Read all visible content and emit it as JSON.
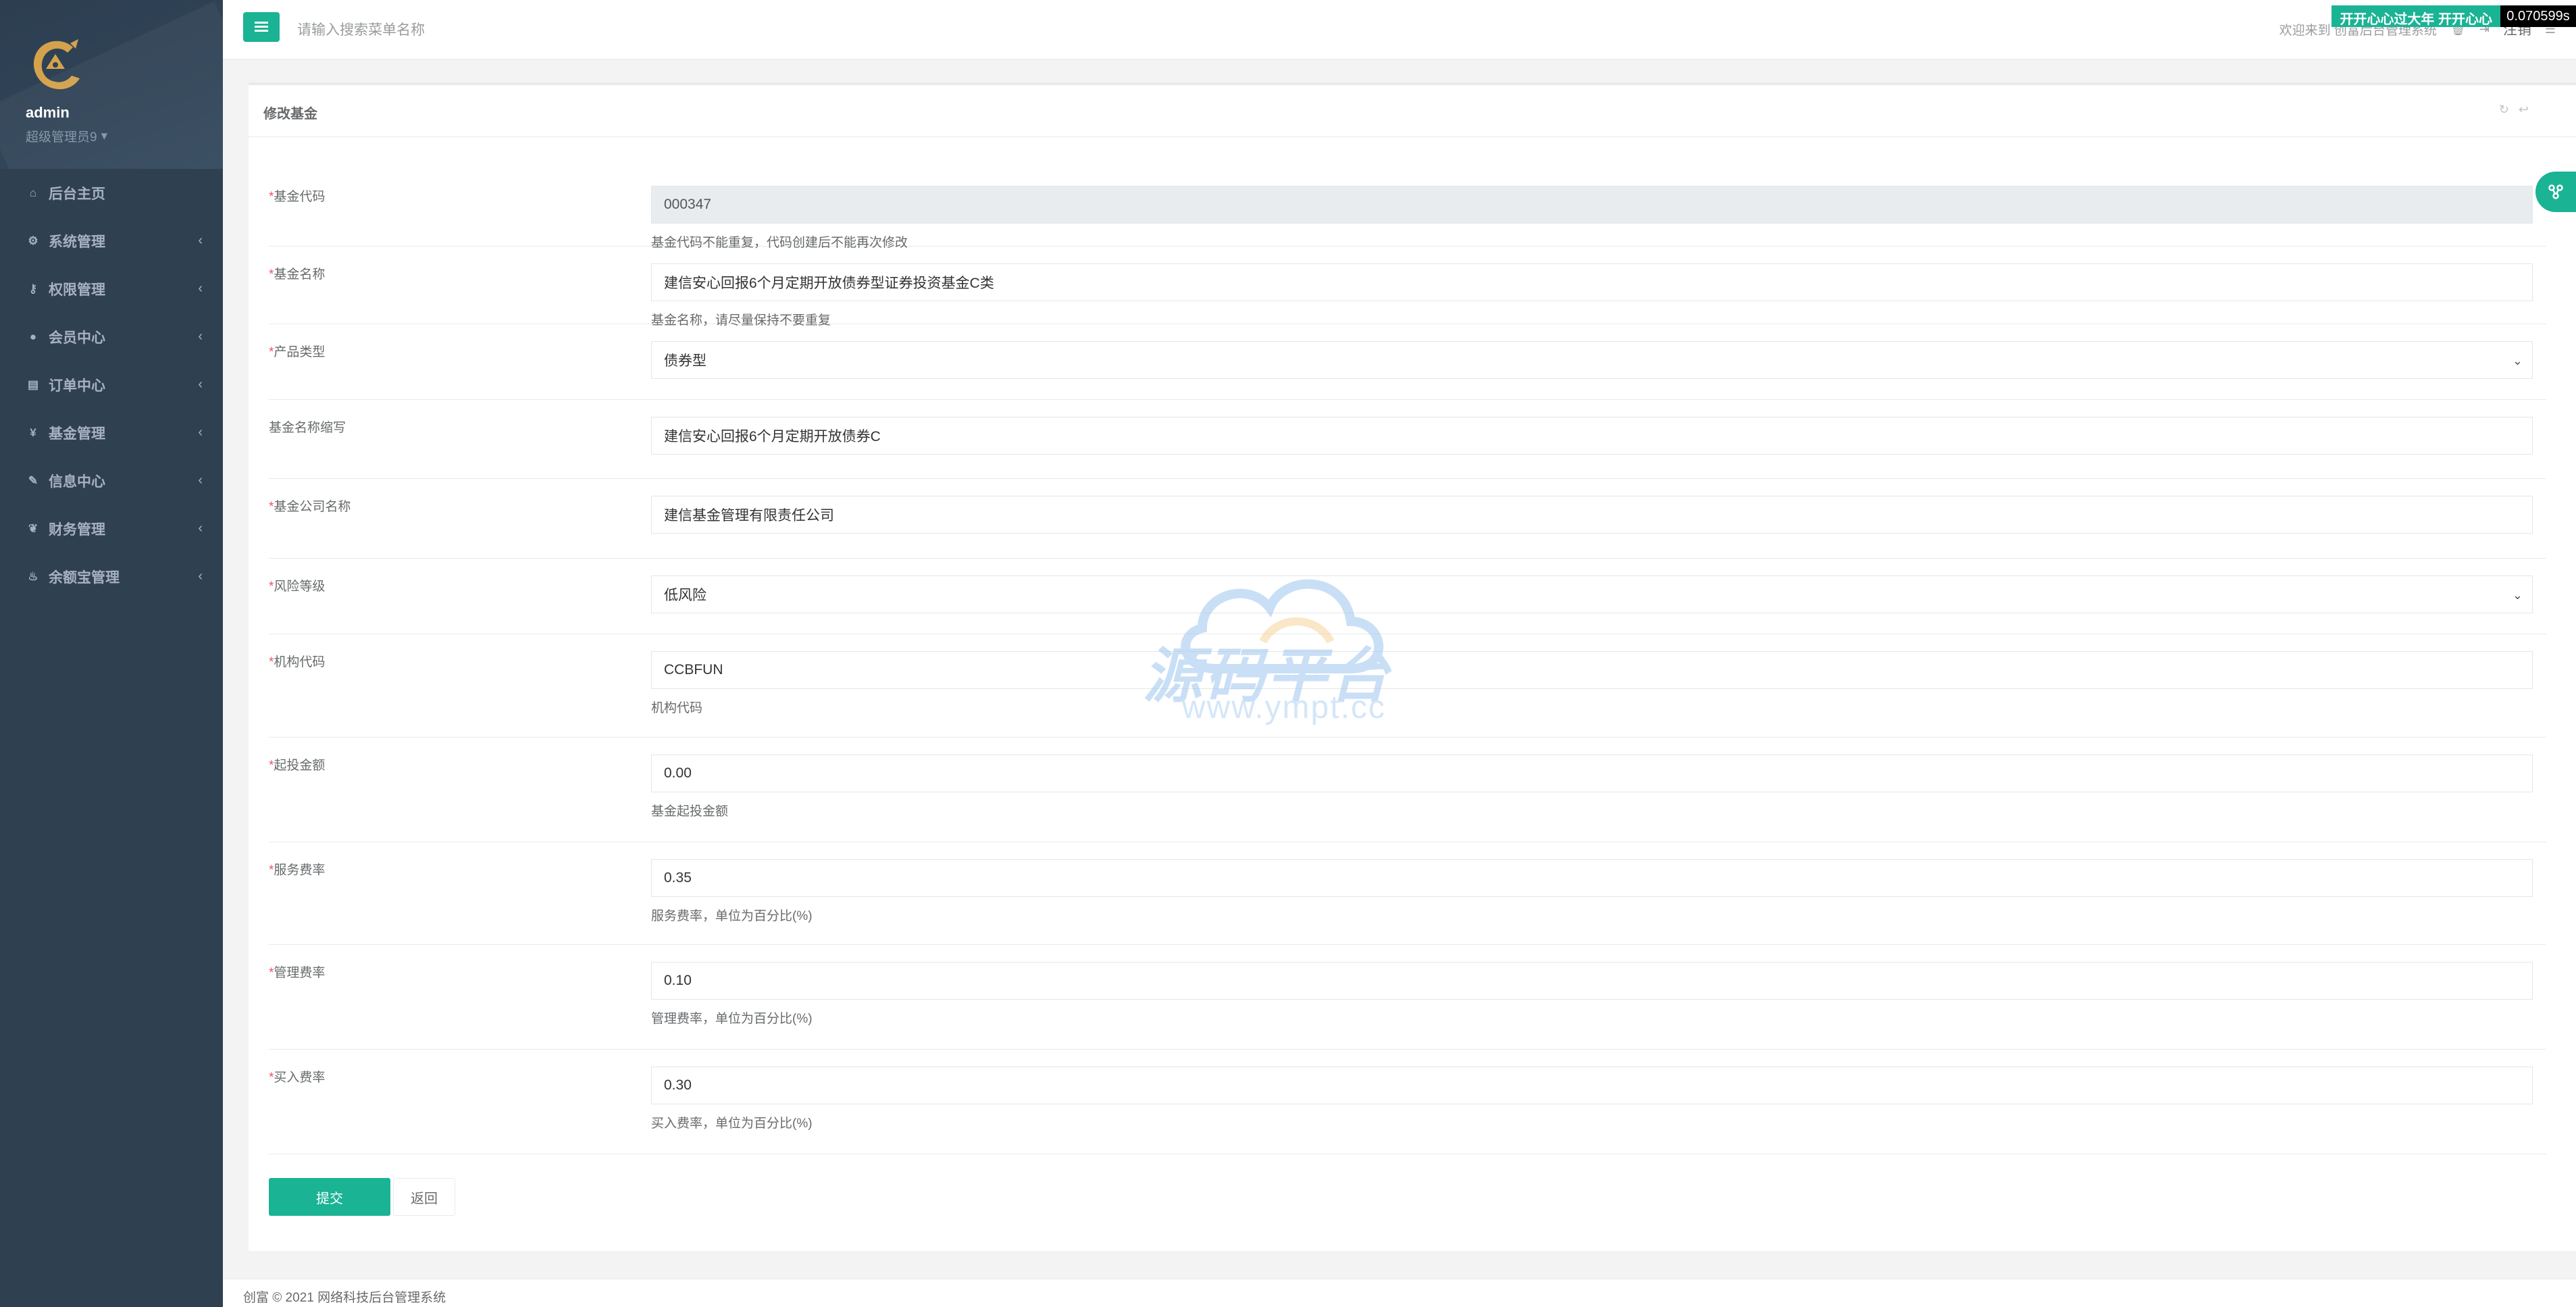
{
  "sidebar": {
    "user": {
      "name": "admin",
      "role": "超级管理员9"
    },
    "items": [
      {
        "label": "后台主页",
        "icon": "home-icon",
        "glyph": "⌂",
        "chevron": false
      },
      {
        "label": "系统管理",
        "icon": "cogs-icon",
        "glyph": "⚙",
        "chevron": true
      },
      {
        "label": "权限管理",
        "icon": "key-icon",
        "glyph": "⚷",
        "chevron": true
      },
      {
        "label": "会员中心",
        "icon": "user-icon",
        "glyph": "●",
        "chevron": true
      },
      {
        "label": "订单中心",
        "icon": "list-alt-icon",
        "glyph": "▤",
        "chevron": true
      },
      {
        "label": "基金管理",
        "icon": "yen-icon",
        "glyph": "¥",
        "chevron": true
      },
      {
        "label": "信息中心",
        "icon": "wrench-icon",
        "glyph": "✎",
        "chevron": true
      },
      {
        "label": "财务管理",
        "icon": "leaf-icon",
        "glyph": "❦",
        "chevron": true
      },
      {
        "label": "余额宝管理",
        "icon": "fire-icon",
        "glyph": "♨",
        "chevron": true
      }
    ],
    "chevron_glyph": "‹"
  },
  "header": {
    "search_placeholder": "请输入搜索菜单名称",
    "welcome": "欢迎来到 创富后台管理系统",
    "logout": "注销"
  },
  "panel": {
    "title": "修改基金"
  },
  "form": {
    "rows": [
      {
        "label": "基金代码",
        "required": true,
        "value": "000347",
        "type": "text",
        "disabled": true,
        "help": "基金代码不能重复，代码创建后不能再次修改"
      },
      {
        "label": "基金名称",
        "required": true,
        "value": "建信安心回报6个月定期开放债券型证券投资基金C类",
        "type": "text",
        "disabled": false,
        "help": "基金名称，请尽量保持不要重复"
      },
      {
        "label": "产品类型",
        "required": true,
        "value": "债券型",
        "type": "select",
        "disabled": false,
        "help": ""
      },
      {
        "label": "基金名称缩写",
        "required": false,
        "value": "建信安心回报6个月定期开放债券C",
        "type": "text",
        "disabled": false,
        "help": ""
      },
      {
        "label": "基金公司名称",
        "required": true,
        "value": "建信基金管理有限责任公司",
        "type": "text",
        "disabled": false,
        "help": ""
      },
      {
        "label": "风险等级",
        "required": true,
        "value": "低风险",
        "type": "select",
        "disabled": false,
        "help": ""
      },
      {
        "label": "机构代码",
        "required": true,
        "value": "CCBFUN",
        "type": "text",
        "disabled": false,
        "help": "机构代码"
      },
      {
        "label": "起投金额",
        "required": true,
        "value": "0.00",
        "type": "text",
        "disabled": false,
        "help": "基金起投金额"
      },
      {
        "label": "服务费率",
        "required": true,
        "value": "0.35",
        "type": "text",
        "disabled": false,
        "help": "服务费率，单位为百分比(%)"
      },
      {
        "label": "管理费率",
        "required": true,
        "value": "0.10",
        "type": "text",
        "disabled": false,
        "help": "管理费率，单位为百分比(%)"
      },
      {
        "label": "买入费率",
        "required": true,
        "value": "0.30",
        "type": "text",
        "disabled": false,
        "help": "买入费率，单位为百分比(%)"
      }
    ],
    "submit_label": "提交",
    "back_label": "返回"
  },
  "watermark": {
    "text": "源码平台",
    "url": "www.ympt.cc"
  },
  "footer": {
    "copyright": "创富 © 2021 网络科技后台管理系统",
    "badge": "开开心心过大年 开开心心",
    "timer": "0.070599s"
  },
  "colors": {
    "accent": "#1ab394",
    "sidebar": "#2f4050",
    "required": "#ed5565"
  }
}
